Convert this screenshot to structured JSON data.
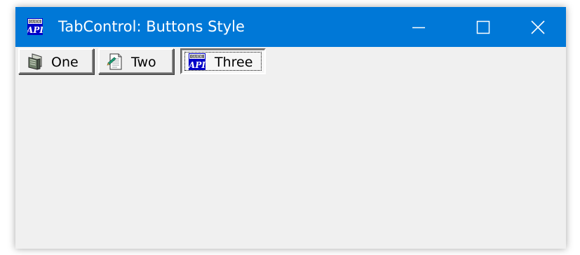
{
  "window": {
    "title": "TabControl: Buttons Style",
    "app_icon": "api-guide-icon",
    "title_bar_color": "#0078d7",
    "background_color": "#f0f0f0"
  },
  "caption_buttons": {
    "minimize_icon": "minimize-icon",
    "maximize_icon": "maximize-icon",
    "close_icon": "close-icon"
  },
  "tabs": [
    {
      "label": "One",
      "icon": "window-document-icon",
      "selected": false
    },
    {
      "label": "Two",
      "icon": "notepad-icon",
      "selected": false
    },
    {
      "label": "Three",
      "icon": "api-guide-icon",
      "selected": true
    }
  ]
}
